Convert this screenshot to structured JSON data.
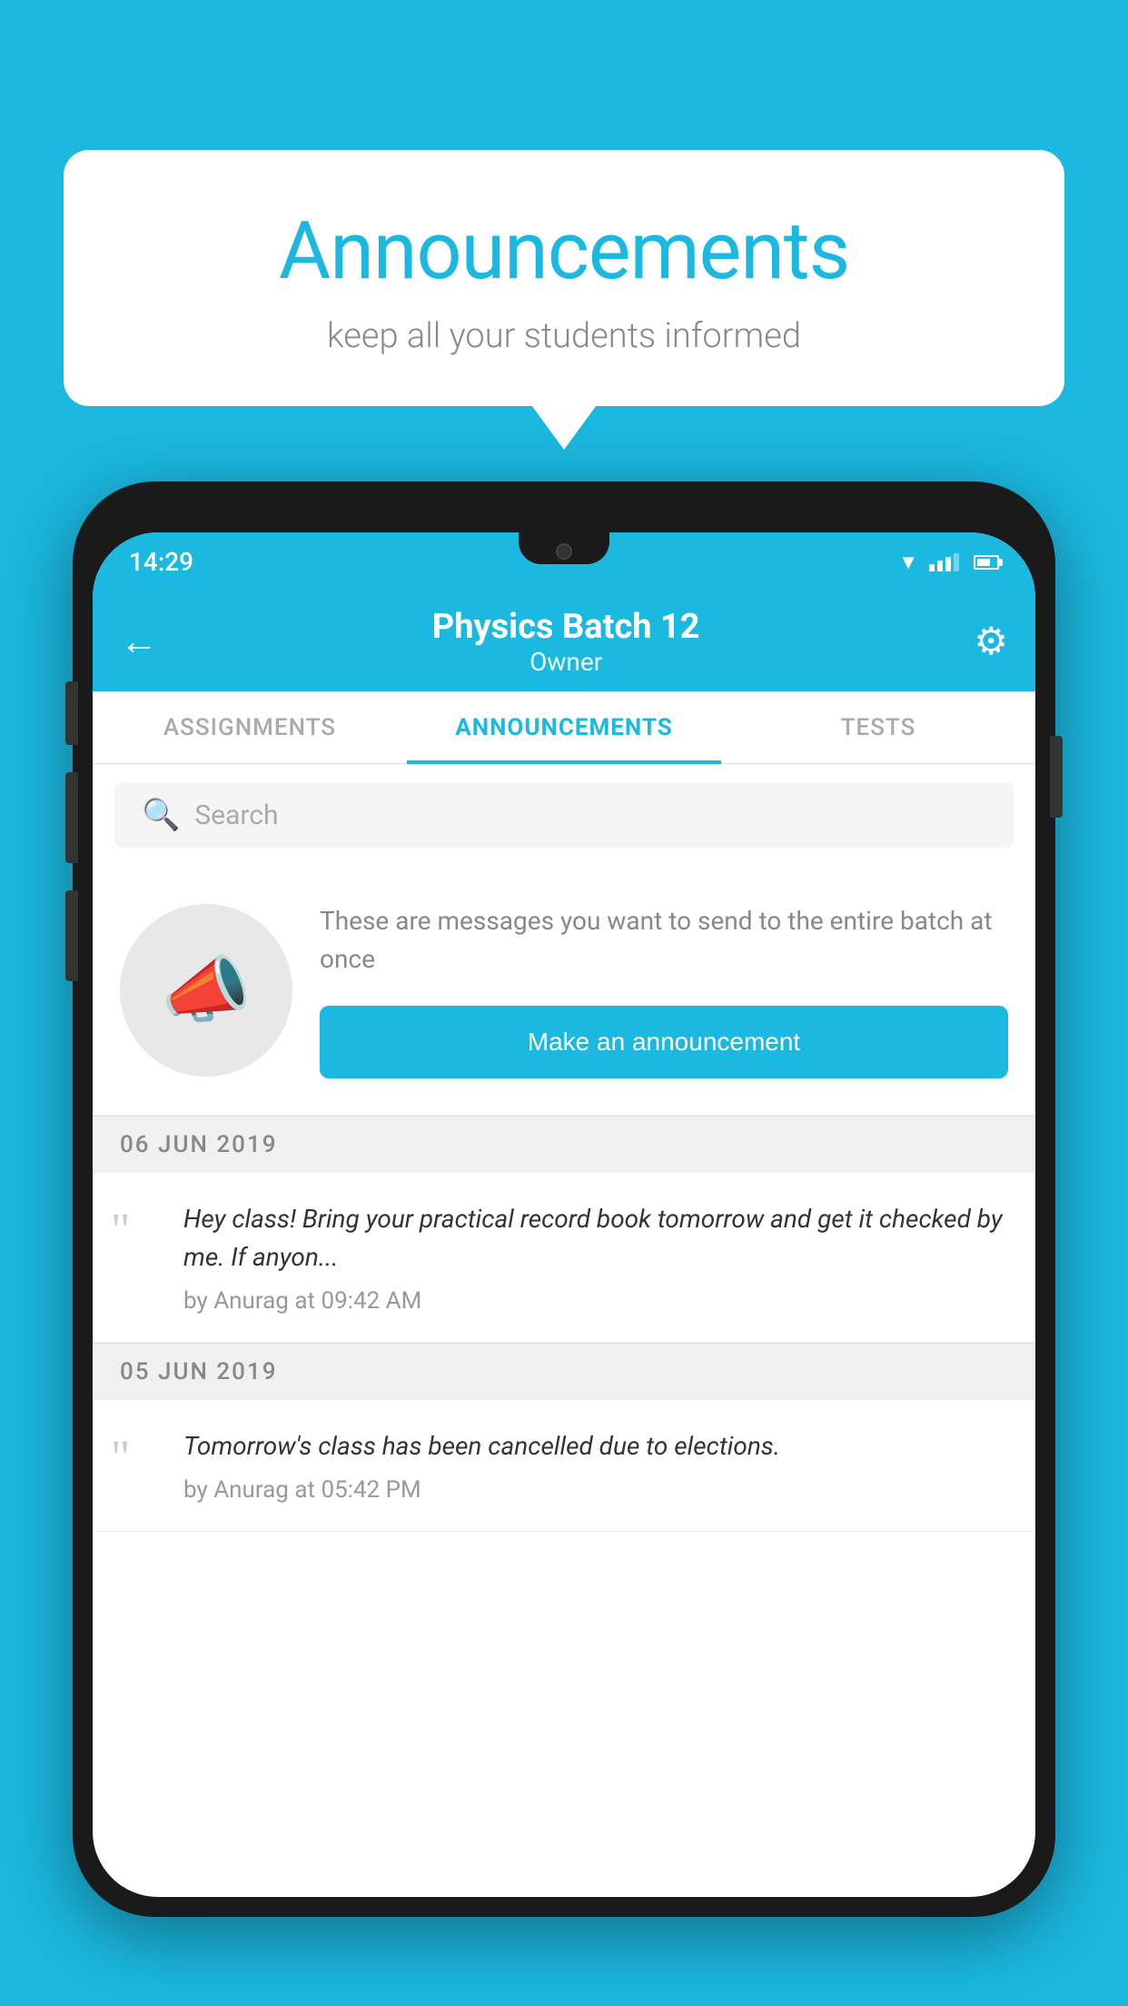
{
  "background_color": "#1BB8E0",
  "speech_bubble": {
    "title": "Announcements",
    "subtitle": "keep all your students informed"
  },
  "status_bar": {
    "time": "14:29"
  },
  "app_bar": {
    "title": "Physics Batch 12",
    "subtitle": "Owner",
    "back_label": "←",
    "gear_label": "⚙"
  },
  "tabs": [
    {
      "label": "ASSIGNMENTS",
      "active": false
    },
    {
      "label": "ANNOUNCEMENTS",
      "active": true
    },
    {
      "label": "TESTS",
      "active": false
    }
  ],
  "search": {
    "placeholder": "Search"
  },
  "announcement_prompt": {
    "description": "These are messages you want to send to the entire batch at once",
    "button_label": "Make an announcement"
  },
  "announcements": [
    {
      "date": "06  JUN  2019",
      "message": "Hey class! Bring your practical record book tomorrow and get it checked by me. If anyon...",
      "meta": "by Anurag at 09:42 AM"
    },
    {
      "date": "05  JUN  2019",
      "message": "Tomorrow's class has been cancelled due to elections.",
      "meta": "by Anurag at 05:42 PM"
    }
  ]
}
